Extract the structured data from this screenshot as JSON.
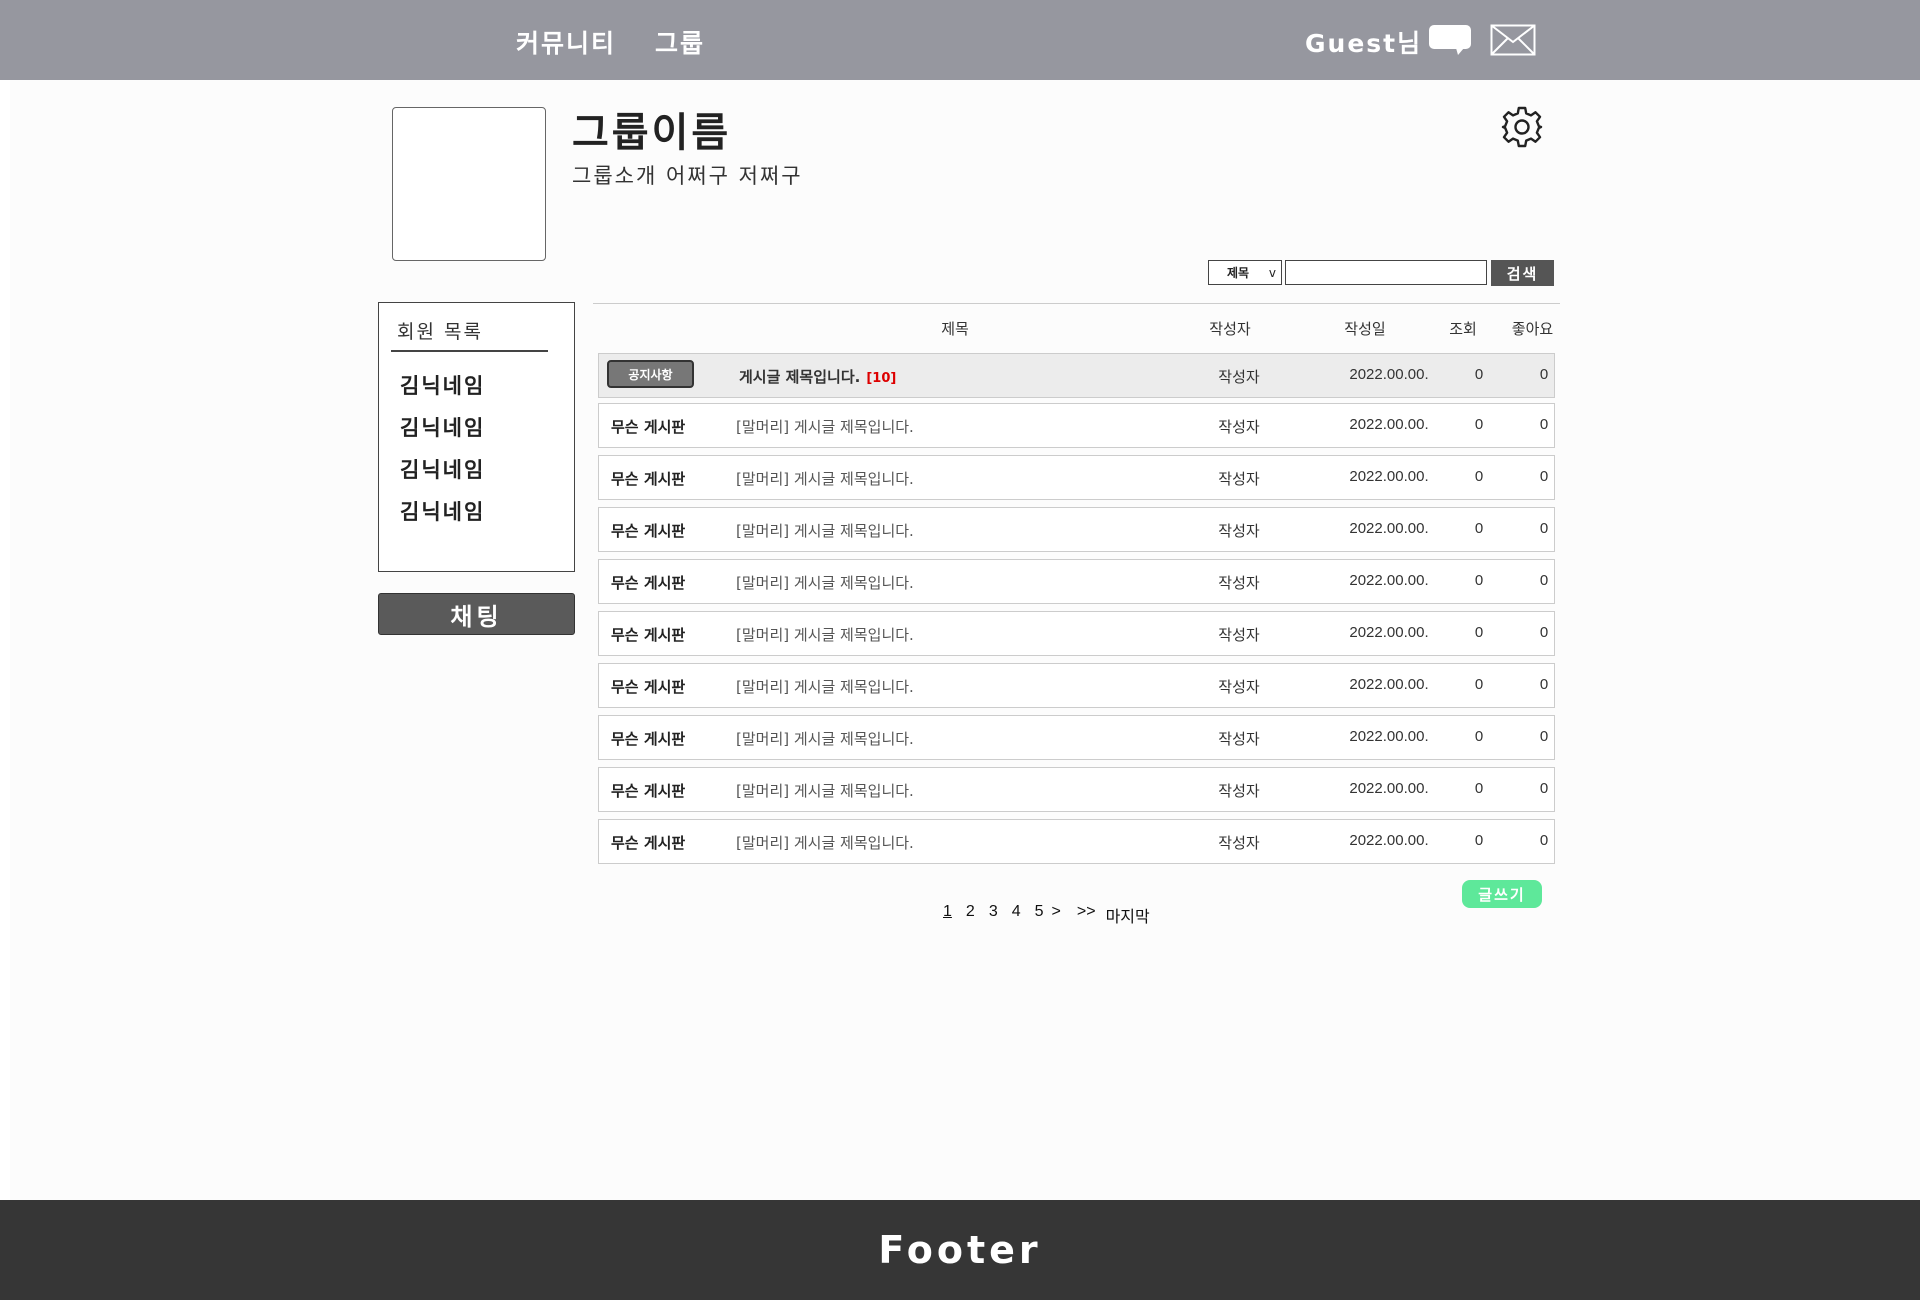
{
  "header": {
    "nav": [
      "커뮤니티",
      "그룹"
    ],
    "guest_label": "Guest님"
  },
  "group": {
    "name": "그룹이름",
    "description": "그룹소개 어쩌구 저쩌구"
  },
  "search": {
    "select_value": "제목",
    "select_arrow": "v",
    "input_value": "",
    "button_label": "검색"
  },
  "members": {
    "title": "회원 목록",
    "items": [
      "김닉네임",
      "김닉네임",
      "김닉네임",
      "김닉네임"
    ]
  },
  "chat_button_label": "채팅",
  "board": {
    "columns": {
      "title": "제목",
      "author": "작성자",
      "date": "작성일",
      "views": "조회",
      "likes": "좋아요"
    },
    "notice": {
      "badge": "공지사항",
      "title": "게시글 제목입니다.",
      "comment_count": "[10]",
      "author": "작성자",
      "date": "2022.00.00.",
      "views": "0",
      "likes": "0"
    },
    "rows": [
      {
        "category": "무슨 게시판",
        "title": "[말머리] 게시글 제목입니다.",
        "author": "작성자",
        "date": "2022.00.00.",
        "views": "0",
        "likes": "0"
      },
      {
        "category": "무슨 게시판",
        "title": "[말머리] 게시글 제목입니다.",
        "author": "작성자",
        "date": "2022.00.00.",
        "views": "0",
        "likes": "0"
      },
      {
        "category": "무슨 게시판",
        "title": "[말머리] 게시글 제목입니다.",
        "author": "작성자",
        "date": "2022.00.00.",
        "views": "0",
        "likes": "0"
      },
      {
        "category": "무슨 게시판",
        "title": "[말머리] 게시글 제목입니다.",
        "author": "작성자",
        "date": "2022.00.00.",
        "views": "0",
        "likes": "0"
      },
      {
        "category": "무슨 게시판",
        "title": "[말머리] 게시글 제목입니다.",
        "author": "작성자",
        "date": "2022.00.00.",
        "views": "0",
        "likes": "0"
      },
      {
        "category": "무슨 게시판",
        "title": "[말머리] 게시글 제목입니다.",
        "author": "작성자",
        "date": "2022.00.00.",
        "views": "0",
        "likes": "0"
      },
      {
        "category": "무슨 게시판",
        "title": "[말머리] 게시글 제목입니다.",
        "author": "작성자",
        "date": "2022.00.00.",
        "views": "0",
        "likes": "0"
      },
      {
        "category": "무슨 게시판",
        "title": "[말머리] 게시글 제목입니다.",
        "author": "작성자",
        "date": "2022.00.00.",
        "views": "0",
        "likes": "0"
      },
      {
        "category": "무슨 게시판",
        "title": "[말머리] 게시글 제목입니다.",
        "author": "작성자",
        "date": "2022.00.00.",
        "views": "0",
        "likes": "0"
      }
    ],
    "write_button_label": "글쓰기"
  },
  "pagination": {
    "pages": [
      "1",
      "2",
      "3",
      "4",
      "5"
    ],
    "current": "1",
    "next": ">",
    "next_block": ">>",
    "last": "마지막"
  },
  "footer": {
    "text": "Footer"
  },
  "colors": {
    "header_bg": "#96979f",
    "footer_bg": "#363636",
    "write_button": "#5ee89a",
    "comment_count": "#dd0000"
  },
  "icons": {
    "chat": "chat-bubble-icon",
    "mail": "mail-icon",
    "settings": "gear-icon"
  }
}
